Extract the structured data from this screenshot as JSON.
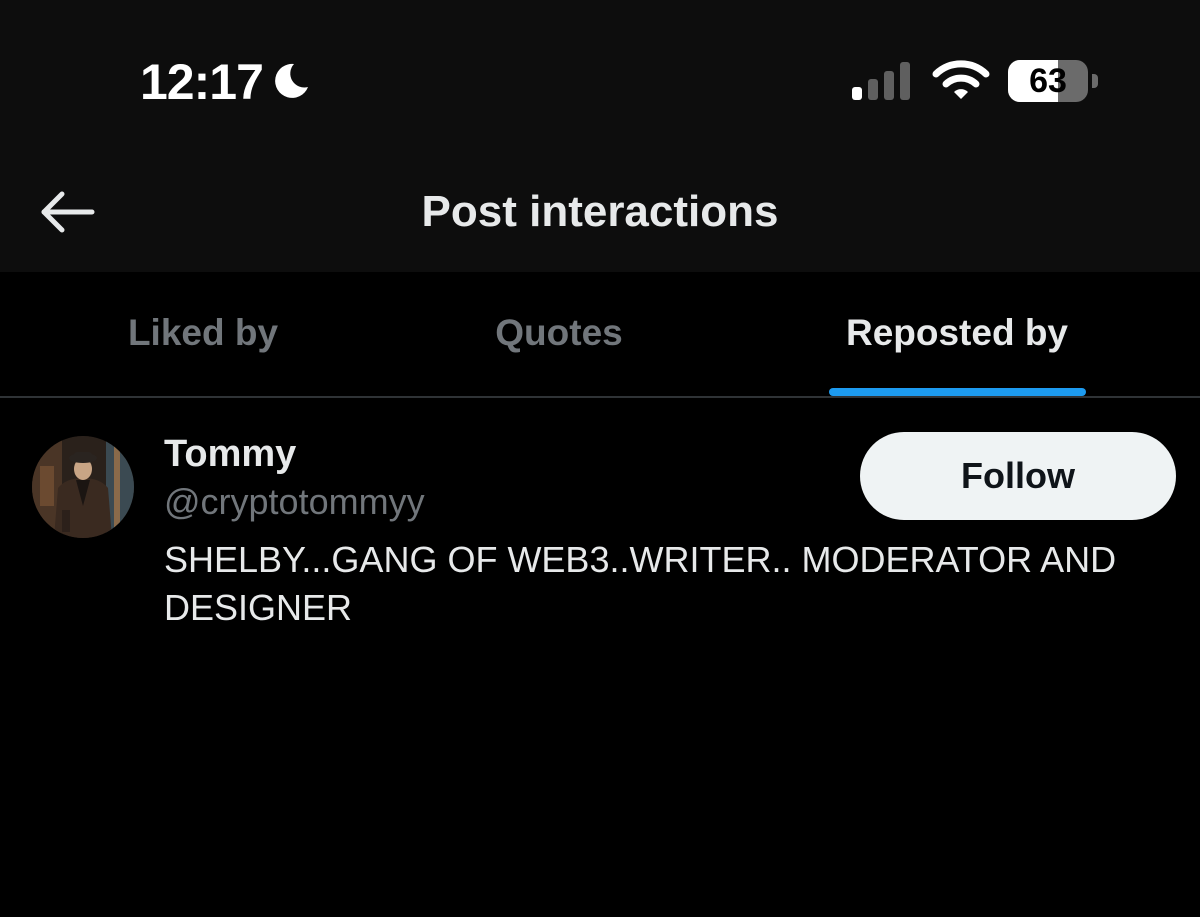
{
  "status_bar": {
    "time": "12:17",
    "battery_level": "63",
    "battery_fraction": 0.63,
    "icons": [
      "moon-icon",
      "cellular-signal-icon",
      "wifi-icon",
      "battery-icon"
    ]
  },
  "header": {
    "title": "Post interactions",
    "back_icon": "arrow-left-icon"
  },
  "tabs": [
    {
      "label": "Liked by",
      "active": false
    },
    {
      "label": "Quotes",
      "active": false
    },
    {
      "label": "Reposted by",
      "active": true
    }
  ],
  "users": [
    {
      "display_name": "Tommy",
      "handle": "@cryptotommyy",
      "bio": "SHELBY...GANG OF WEB3..WRITER.. MODERATOR AND DESIGNER",
      "follow_label": "Follow"
    }
  ],
  "colors": {
    "background": "#000000",
    "header_background": "#0d0d0d",
    "primary_text": "#e7e9ea",
    "secondary_text": "#71767b",
    "accent": "#1d9bf0",
    "follow_button_bg": "#eff3f4",
    "divider": "#2f3336"
  }
}
